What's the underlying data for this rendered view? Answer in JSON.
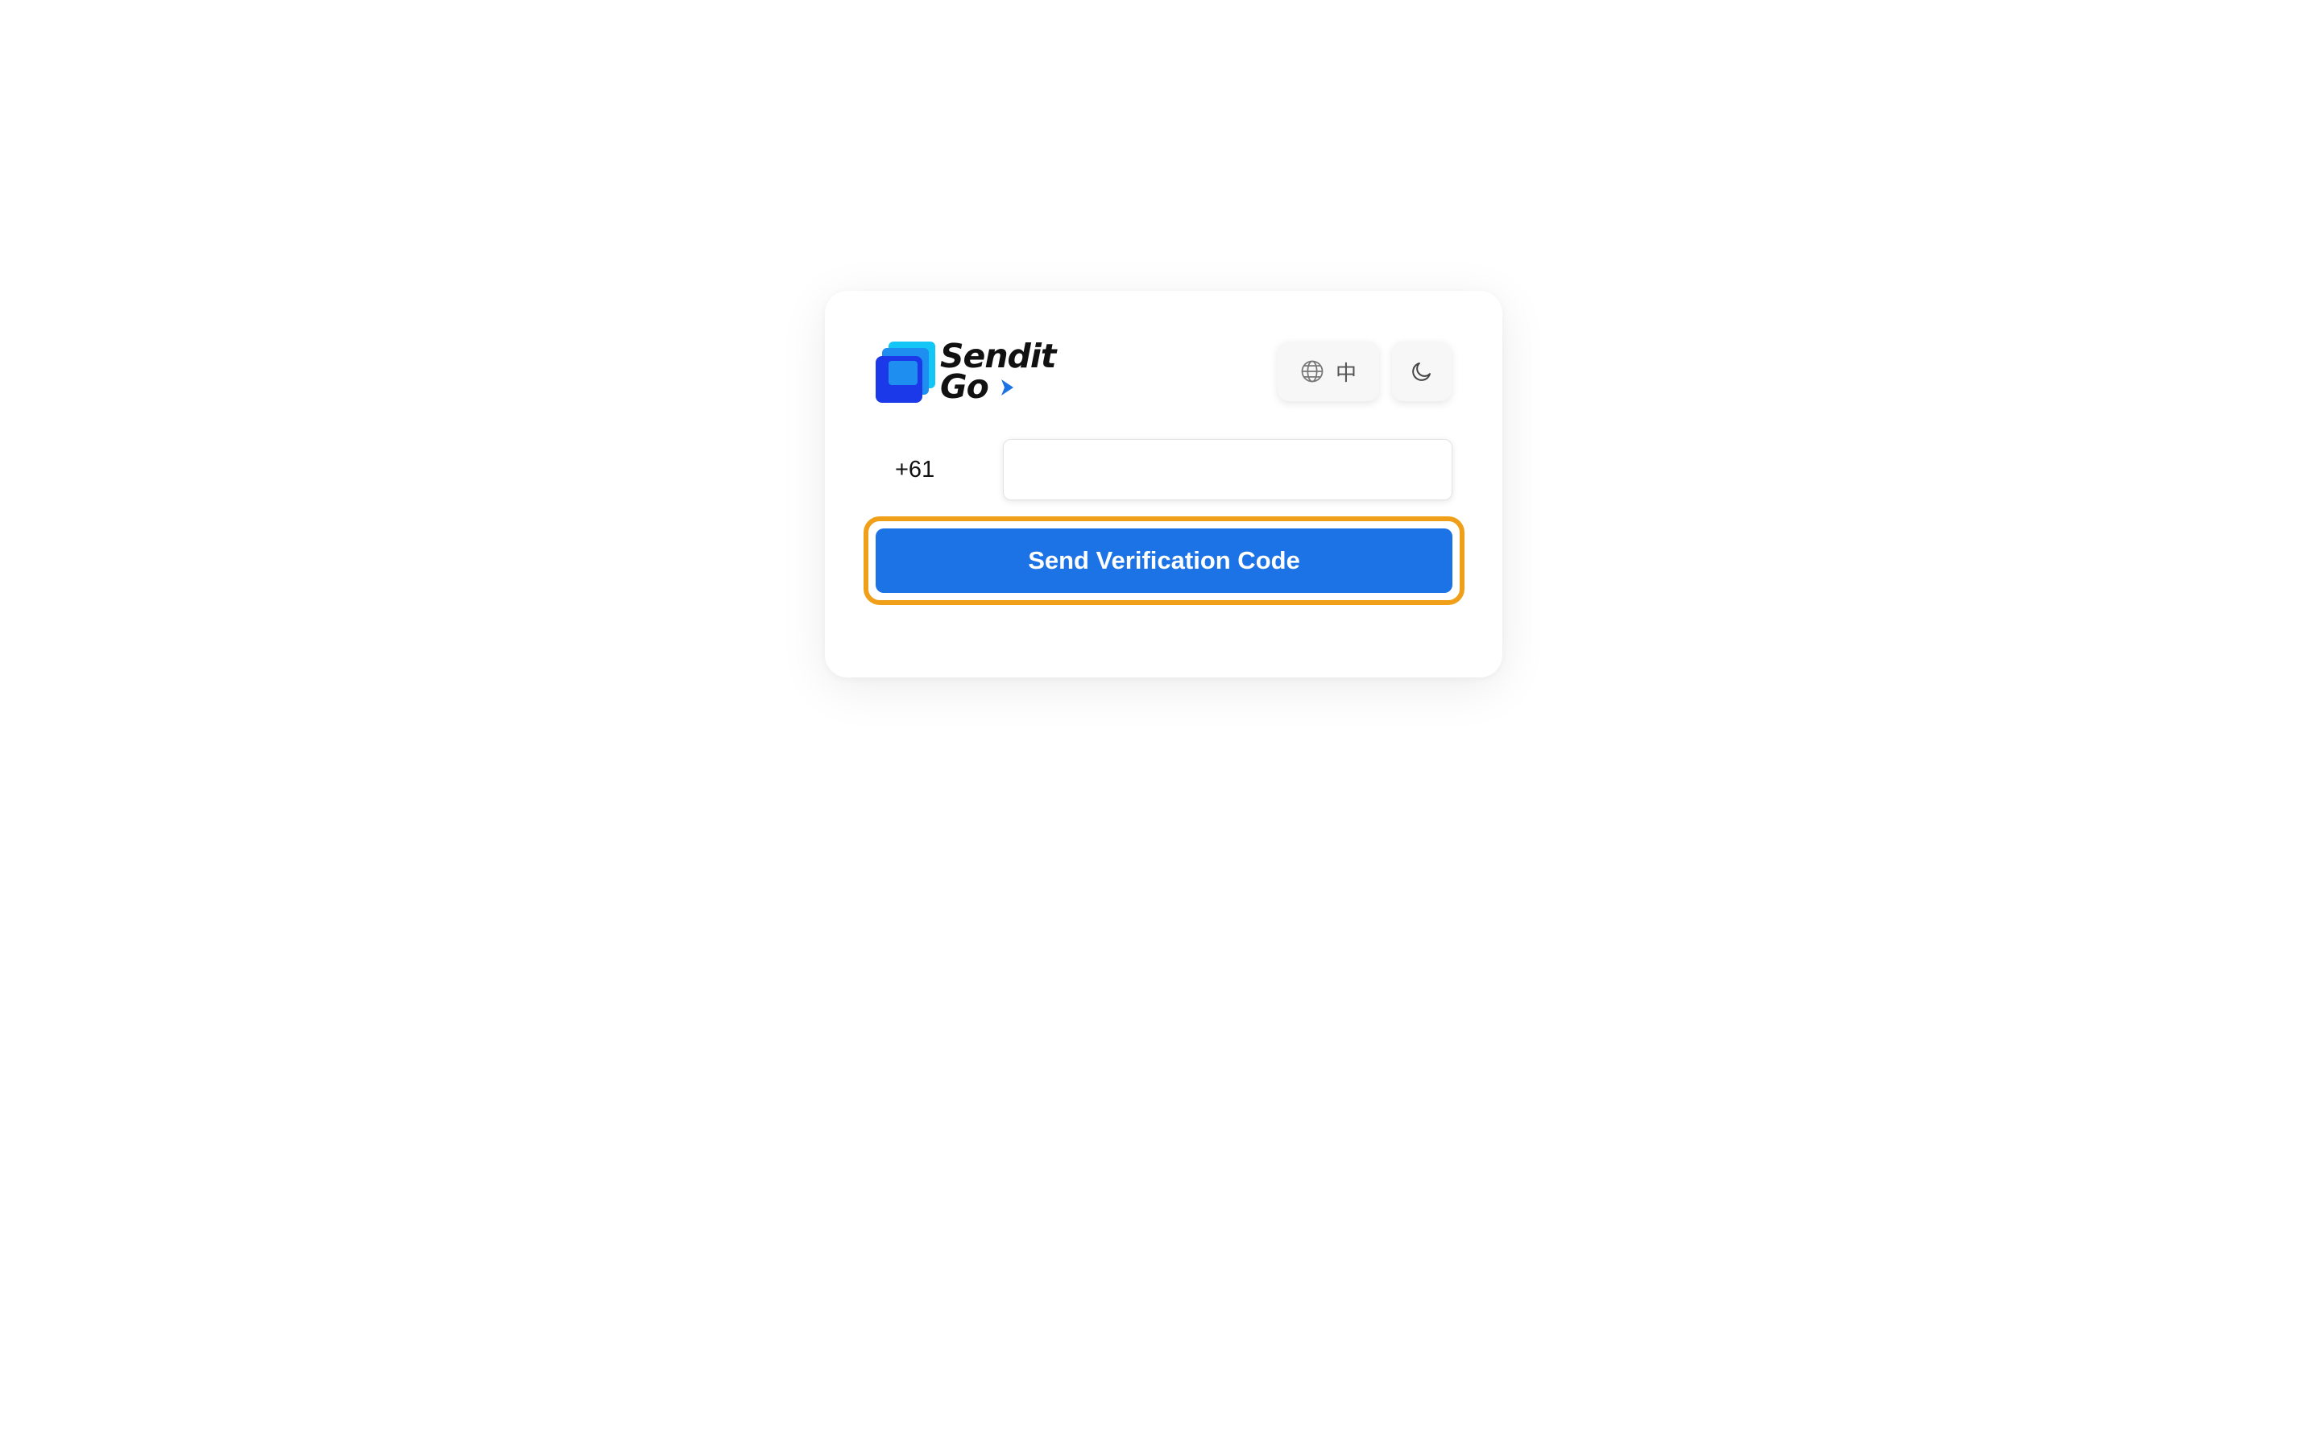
{
  "brand": {
    "name_line1": "Sendit",
    "name_line2": "Go",
    "colors": {
      "primary": "#1c73e6",
      "logo_dark_blue": "#1b39e8",
      "logo_cyan": "#13c6f5",
      "focus_ring": "#f0a018"
    }
  },
  "header": {
    "language_toggle": {
      "icon": "globe-icon",
      "label": "中"
    },
    "theme_toggle": {
      "icon": "moon-icon"
    }
  },
  "form": {
    "country_code": "+61",
    "phone_value": "",
    "phone_placeholder": "",
    "send_button_label": "Send Verification Code"
  }
}
